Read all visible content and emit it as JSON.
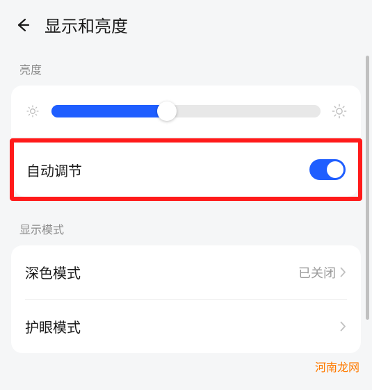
{
  "header": {
    "title": "显示和亮度"
  },
  "brightness": {
    "section_label": "亮度",
    "slider_percent": 43,
    "auto_adjust_label": "自动调节",
    "auto_adjust_on": true
  },
  "display_mode": {
    "section_label": "显示模式",
    "dark_mode_label": "深色模式",
    "dark_mode_value": "已关闭",
    "eye_comfort_label": "护眼模式"
  },
  "watermark": "河南龙网",
  "colors": {
    "accent": "#1f5eff",
    "highlight_border": "#ff1a1a"
  }
}
